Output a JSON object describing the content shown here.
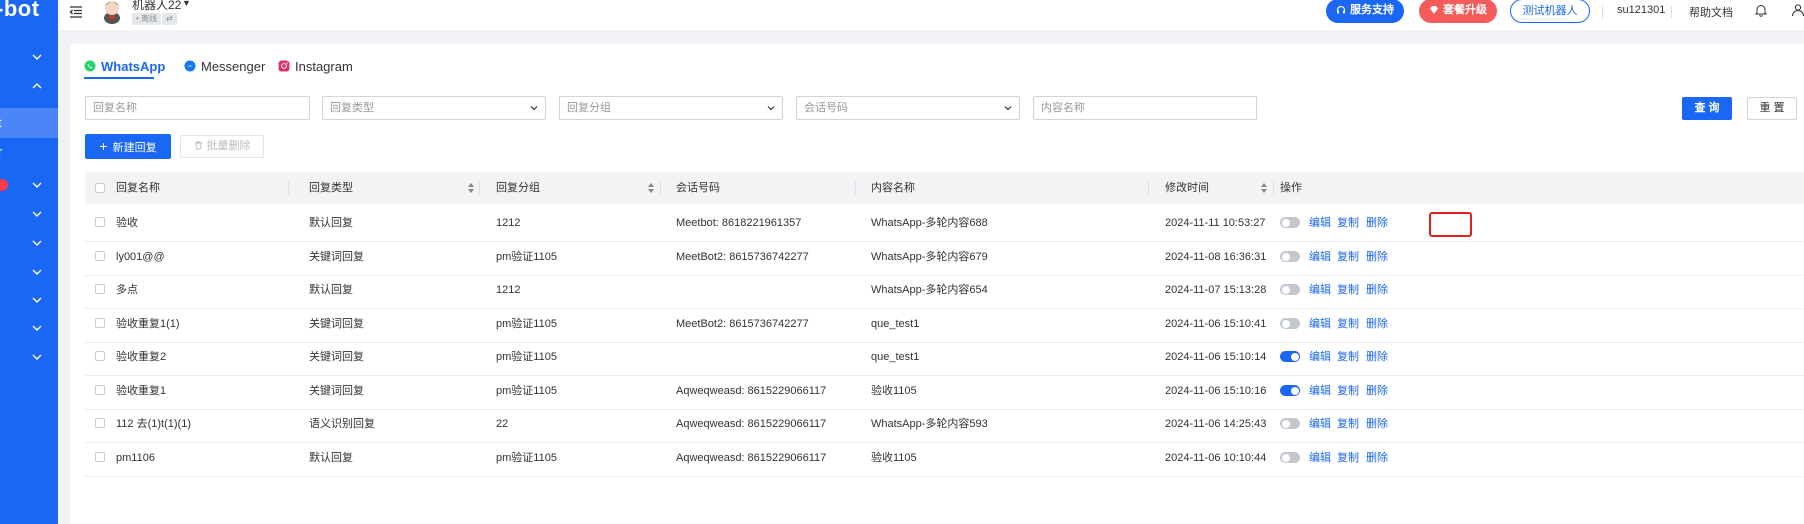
{
  "brand": {
    "logo_text": "-bot"
  },
  "sidebar": {
    "items": [
      {
        "label": "",
        "expanded": false
      },
      {
        "label": "",
        "expanded": true
      },
      {
        "label": "t",
        "active": true
      },
      {
        "label": "r"
      },
      {
        "label": "",
        "expanded": false,
        "badge": true
      },
      {
        "label": "",
        "expanded": false
      },
      {
        "label": "",
        "expanded": false
      },
      {
        "label": "",
        "expanded": false
      },
      {
        "label": "",
        "expanded": false
      },
      {
        "label": "",
        "expanded": false
      },
      {
        "label": "",
        "expanded": false
      }
    ]
  },
  "topbar": {
    "bot_name": "机器人22",
    "bot_status": "• 离线",
    "bot_ext": "⇄",
    "support_label": "服务支持",
    "upgrade_label": "套餐升级",
    "test_bot_label": "测试机器人",
    "username": "su121301",
    "help_label": "帮助文档",
    "colors": {
      "primary": "#1a66f5",
      "upgrade": "#f45b5b"
    }
  },
  "tabs": [
    {
      "label": "WhatsApp",
      "active": true,
      "icon": "whatsapp-icon"
    },
    {
      "label": "Messenger",
      "active": false,
      "icon": "messenger-icon"
    },
    {
      "label": "Instagram",
      "active": false,
      "icon": "instagram-icon"
    }
  ],
  "filters": {
    "reply_name_placeholder": "回复名称",
    "reply_type_placeholder": "回复类型",
    "reply_group_placeholder": "回复分组",
    "session_number_placeholder": "会话号码",
    "content_name_placeholder": "内容名称",
    "query_label": "查 询",
    "reset_label": "重 置"
  },
  "actions": {
    "new_reply_label": "新建回复",
    "batch_delete_label": "批量删除"
  },
  "table": {
    "columns": {
      "name": "回复名称",
      "type": "回复类型",
      "group": "回复分组",
      "session": "会话号码",
      "content": "内容名称",
      "modified": "修改时间",
      "ops": "操作"
    },
    "op_labels": {
      "edit": "编辑",
      "copy": "复制",
      "delete": "删除"
    },
    "rows": [
      {
        "name": "验收",
        "type": "默认回复",
        "group": "1212",
        "session": "Meetbot: 8618221961357",
        "content": "WhatsApp-多轮内容688",
        "modified": "2024-11-11 10:53:27",
        "enabled": false
      },
      {
        "name": "ly001@@",
        "type": "关键词回复",
        "group": "pm验证1105",
        "session": "MeetBot2: 8615736742277",
        "content": "WhatsApp-多轮内容679",
        "modified": "2024-11-08 16:36:31",
        "enabled": false
      },
      {
        "name": "多点",
        "type": "默认回复",
        "group": "1212",
        "session": "",
        "content": "WhatsApp-多轮内容654",
        "modified": "2024-11-07 15:13:28",
        "enabled": false
      },
      {
        "name": "验收重复1(1)",
        "type": "关键词回复",
        "group": "pm验证1105",
        "session": "MeetBot2: 8615736742277",
        "content": "que_test1",
        "modified": "2024-11-06 15:10:41",
        "enabled": false
      },
      {
        "name": "验收重复2",
        "type": "关键词回复",
        "group": "pm验证1105",
        "session": "",
        "content": "que_test1",
        "modified": "2024-11-06 15:10:14",
        "enabled": true
      },
      {
        "name": "验收重复1",
        "type": "关键词回复",
        "group": "pm验证1105",
        "session": "Aqweqweasd: 8615229066117",
        "content": "验收1105",
        "modified": "2024-11-06 15:10:16",
        "enabled": true
      },
      {
        "name": "112 去(1)t(1)(1)",
        "type": "语义识别回复",
        "group": "22",
        "session": "Aqweqweasd: 8615229066117",
        "content": "WhatsApp-多轮内容593",
        "modified": "2024-11-06 14:25:43",
        "enabled": false
      },
      {
        "name": "pm1106",
        "type": "默认回复",
        "group": "pm验证1105",
        "session": "Aqweqweasd: 8615229066117",
        "content": "验收1105",
        "modified": "2024-11-06 10:10:44",
        "enabled": false
      }
    ]
  }
}
